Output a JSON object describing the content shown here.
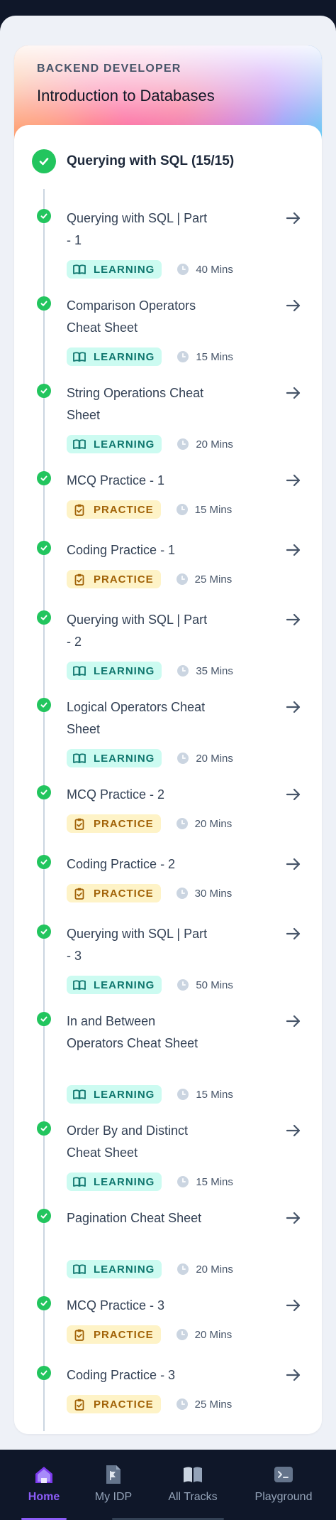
{
  "course": {
    "track": "BACKEND DEVELOPER",
    "title": "Introduction to Databases"
  },
  "section": {
    "title": "Querying with SQL (15/15)"
  },
  "items": [
    {
      "title": "Querying with SQL | Part - 1",
      "type": "LEARNING",
      "duration": "40 Mins"
    },
    {
      "title": "Comparison Operators Cheat Sheet",
      "type": "LEARNING",
      "duration": "15 Mins"
    },
    {
      "title": "String Operations Cheat Sheet",
      "type": "LEARNING",
      "duration": "20 Mins"
    },
    {
      "title": "MCQ Practice - 1",
      "type": "PRACTICE",
      "duration": "15 Mins"
    },
    {
      "title": "Coding Practice - 1",
      "type": "PRACTICE",
      "duration": "25 Mins"
    },
    {
      "title": "Querying with SQL | Part - 2",
      "type": "LEARNING",
      "duration": "35 Mins"
    },
    {
      "title": "Logical Operators Cheat Sheet",
      "type": "LEARNING",
      "duration": "20 Mins"
    },
    {
      "title": "MCQ Practice - 2",
      "type": "PRACTICE",
      "duration": "20 Mins"
    },
    {
      "title": "Coding Practice - 2",
      "type": "PRACTICE",
      "duration": "30 Mins"
    },
    {
      "title": "Querying with SQL | Part - 3",
      "type": "LEARNING",
      "duration": "50 Mins"
    },
    {
      "title": "In and Between Operators Cheat Sheet",
      "type": "LEARNING",
      "duration": "15 Mins"
    },
    {
      "title": "Order By and Distinct Cheat Sheet",
      "type": "LEARNING",
      "duration": "15 Mins"
    },
    {
      "title": "Pagination Cheat Sheet",
      "type": "LEARNING",
      "duration": "20 Mins"
    },
    {
      "title": "MCQ Practice - 3",
      "type": "PRACTICE",
      "duration": "20 Mins"
    },
    {
      "title": "Coding Practice - 3",
      "type": "PRACTICE",
      "duration": "25 Mins"
    }
  ],
  "nav": {
    "items": [
      {
        "label": "Home",
        "icon": "home-icon",
        "active": true
      },
      {
        "label": "My IDP",
        "icon": "document-icon",
        "active": false
      },
      {
        "label": "All Tracks",
        "icon": "book-open-icon",
        "active": false
      },
      {
        "label": "Playground",
        "icon": "terminal-icon",
        "active": false
      }
    ]
  },
  "colors": {
    "accent": "#8b5cf6",
    "complete": "#22c55e",
    "learning_bg": "#ccfbf1",
    "learning_text": "#0f766e",
    "practice_bg": "#fef3c7",
    "practice_text": "#a16207"
  }
}
